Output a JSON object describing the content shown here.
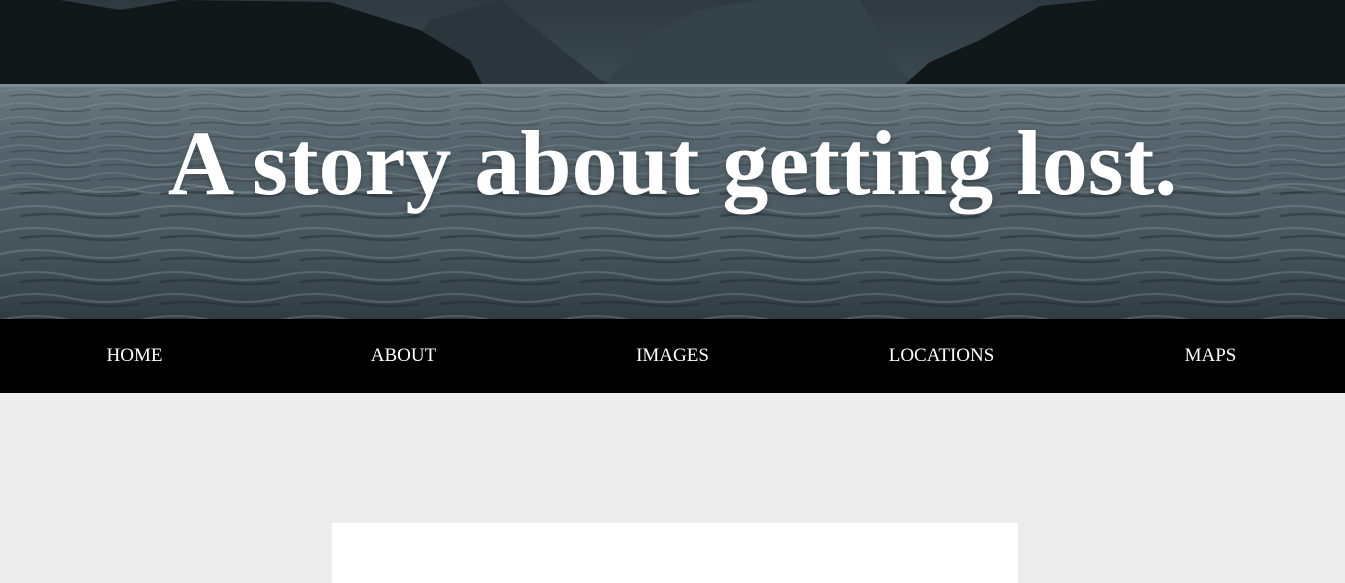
{
  "hero": {
    "title": "A story about getting lost."
  },
  "nav": {
    "items": [
      {
        "label": "HOME"
      },
      {
        "label": "ABOUT"
      },
      {
        "label": "IMAGES"
      },
      {
        "label": "LOCATIONS"
      },
      {
        "label": "MAPS"
      }
    ]
  },
  "colors": {
    "nav_background": "#000000",
    "nav_text": "#ffffff",
    "page_background": "#ececec",
    "card_background": "#ffffff",
    "water": "#4b5a63",
    "mountains": "#151c1f"
  }
}
